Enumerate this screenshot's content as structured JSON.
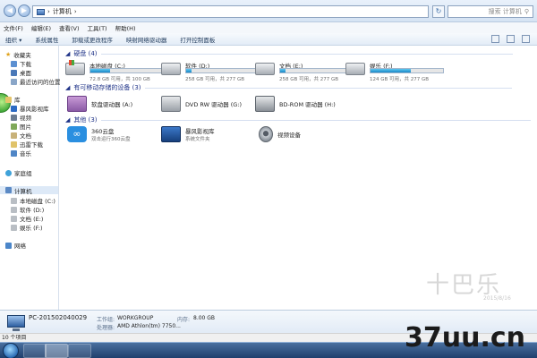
{
  "address": {
    "path": "计算机",
    "search_placeholder": "搜索 计算机"
  },
  "menu": [
    "文件(F)",
    "编辑(E)",
    "查看(V)",
    "工具(T)",
    "帮助(H)"
  ],
  "toolbar": [
    "组织 ▾",
    "系统属性",
    "卸载或更改程序",
    "映射网络驱动器",
    "打开控制面板"
  ],
  "nav": {
    "favorites": "收藏夹",
    "fav_items": [
      "下载",
      "桌面",
      "最近访问的位置"
    ],
    "libraries": "库",
    "lib_items": [
      "暴风影视库",
      "视频",
      "图片",
      "文档",
      "迅雷下载",
      "音乐"
    ],
    "homegroup": "家庭组",
    "computer": "计算机",
    "computer_items": [
      "本地磁盘 (C:)",
      "软件 (D:)",
      "文档 (E:)",
      "娱乐 (F:)"
    ],
    "network": "网络"
  },
  "groups": {
    "hdd": "硬盘 (4)",
    "removable": "有可移动存储的设备 (3)",
    "other": "其他 (3)"
  },
  "drives": [
    {
      "name": "本地磁盘 (C:)",
      "free": "72.8 GB 可用，共 100 GB",
      "used_fraction": 0.27,
      "windows": true
    },
    {
      "name": "软件 (D:)",
      "free": "258 GB 可用，共 277 GB",
      "used_fraction": 0.07,
      "windows": false
    },
    {
      "name": "文档 (E:)",
      "free": "258 GB 可用，共 277 GB",
      "used_fraction": 0.07,
      "windows": false
    },
    {
      "name": "娱乐 (F:)",
      "free": "124 GB 可用，共 277 GB",
      "used_fraction": 0.55,
      "windows": false
    }
  ],
  "removable": [
    "软盘驱动器 (A:)",
    "DVD RW 驱动器 (G:)",
    "BD-ROM 驱动器 (H:)"
  ],
  "other": [
    {
      "name": "360云盘",
      "sub": "双击运行360云盘"
    },
    {
      "name": "暴风影视库",
      "sub": "系统文件夹"
    },
    {
      "name": "视频设备",
      "sub": ""
    }
  ],
  "details": {
    "pc_name": "PC-201502040029",
    "workgroup_label": "工作组:",
    "workgroup": "WORKGROUP",
    "memory_label": "内存:",
    "memory": "8.00 GB",
    "cpu_label": "处理器:",
    "cpu": "AMD Athlon(tm) 7750..."
  },
  "status": "10 个项目",
  "watermark": {
    "logo": "十巴乐",
    "date": "2015/8/16",
    "site": "37uu.cn"
  },
  "colors": {
    "accent": "#1e3287",
    "bar_fill": "#1a86c6",
    "taskbar": "#1f3f6d"
  }
}
